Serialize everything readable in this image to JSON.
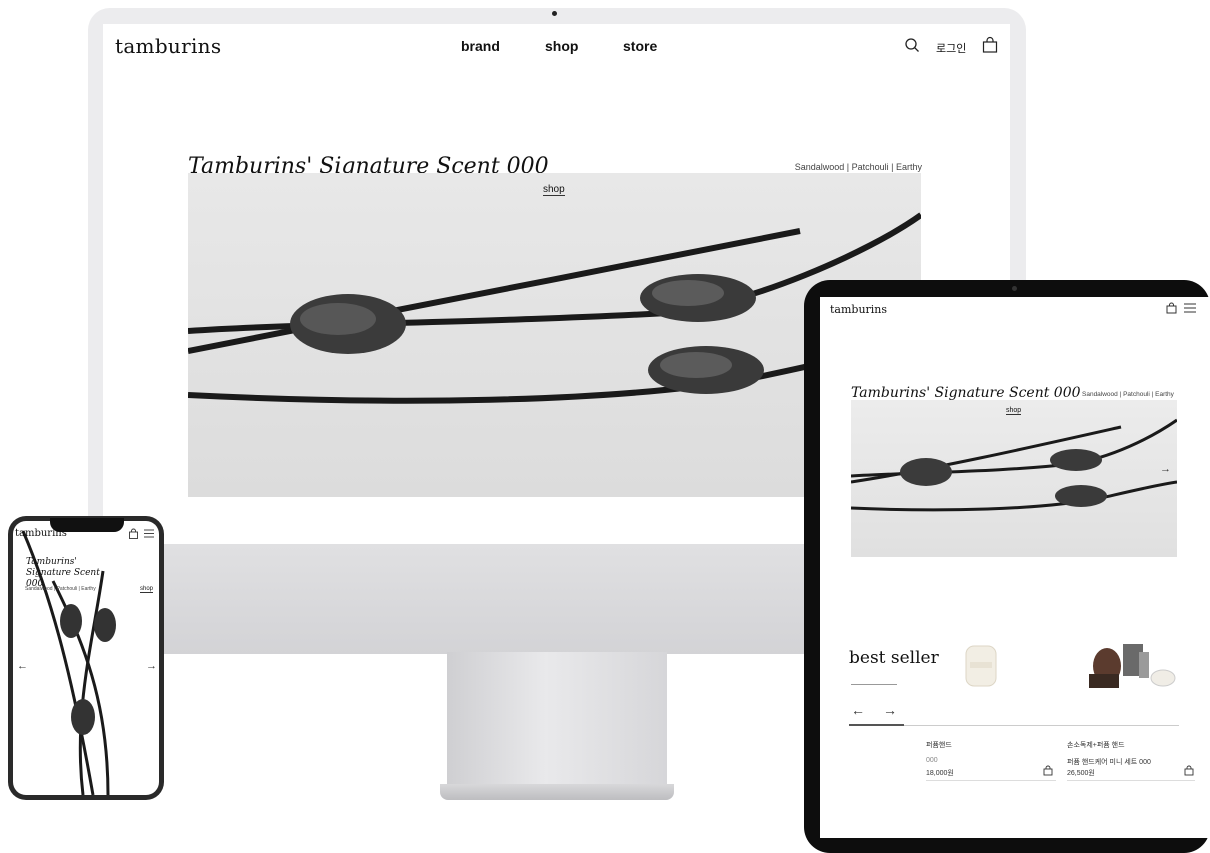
{
  "desktop": {
    "logo": "tamburins",
    "nav": [
      "brand",
      "shop",
      "store"
    ],
    "login_label": "로그인",
    "hero_title": "Tamburins' Signature Scent 000",
    "hero_notes": "Sandalwood | Patchouli | Earthy",
    "hero_link": "shop"
  },
  "tablet": {
    "logo": "tamburins",
    "hero_title": "Tamburins' Signature Scent 000",
    "hero_notes": "Sandalwood | Patchouli | Earthy",
    "hero_link": "shop",
    "best_seller_title": "best seller",
    "products": [
      {
        "category": "퍼퓸핸드",
        "name": "000",
        "price": "18,000원"
      },
      {
        "category": "손소독제+퍼퓸 핸드",
        "name": "퍼퓸 핸드케어 미니 세트 000",
        "price": "26,500원"
      }
    ]
  },
  "mobile": {
    "logo": "tamburins",
    "hero_title": "Tamburins' Signature Scent 000",
    "hero_notes": "Sandalwood | Patchouli | Earthy",
    "hero_link": "shop"
  },
  "icons": {
    "search": "search-icon",
    "bag": "shopping-bag-icon",
    "menu": "hamburger-menu-icon",
    "prev": "arrow-left-icon",
    "next": "arrow-right-icon"
  }
}
